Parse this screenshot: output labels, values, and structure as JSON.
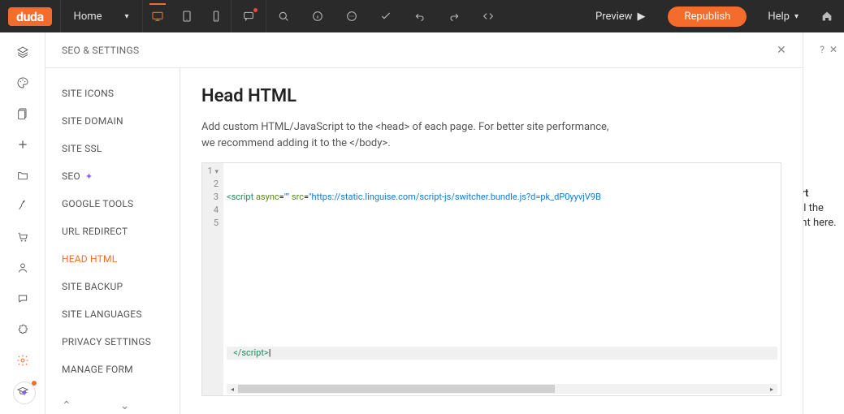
{
  "topbar": {
    "logo": "duda",
    "page_selector": "Home",
    "preview_label": "Preview",
    "republish_label": "Republish",
    "help_label": "Help"
  },
  "panel": {
    "header": "SEO & SETTINGS"
  },
  "sidebar": {
    "items": [
      {
        "label": "SITE ICONS"
      },
      {
        "label": "SITE DOMAIN"
      },
      {
        "label": "SITE SSL"
      },
      {
        "label": "SEO",
        "sparkle": true
      },
      {
        "label": "GOOGLE TOOLS"
      },
      {
        "label": "URL REDIRECT"
      },
      {
        "label": "HEAD HTML",
        "active": true
      },
      {
        "label": "SITE BACKUP"
      },
      {
        "label": "SITE LANGUAGES"
      },
      {
        "label": "PRIVACY SETTINGS"
      },
      {
        "label": "MANAGE FORM"
      }
    ]
  },
  "content": {
    "title": "Head HTML",
    "description": "Add custom HTML/JavaScript to the <head> of each page. For better site performance, we recommend adding it to the </body>."
  },
  "code": {
    "line_numbers": [
      "1",
      "2",
      "3",
      "4",
      "5"
    ],
    "line1_tag_open": "<script",
    "line1_attr_async": " async",
    "line1_eq1": "=",
    "line1_val_async": "\"\"",
    "line1_attr_src": " src",
    "line1_eq2": "=",
    "line1_val_src": "\"https://static.linguise.com/script-js/switcher.bundle.js?d=pk_dP0yyvjV9B",
    "line5_close": "</script>",
    "cursor": "|"
  },
  "right": {
    "help_q": "?",
    "help_x": "✕",
    "hint1": "art",
    "hint2": "all the",
    "hint3": "ght here."
  }
}
